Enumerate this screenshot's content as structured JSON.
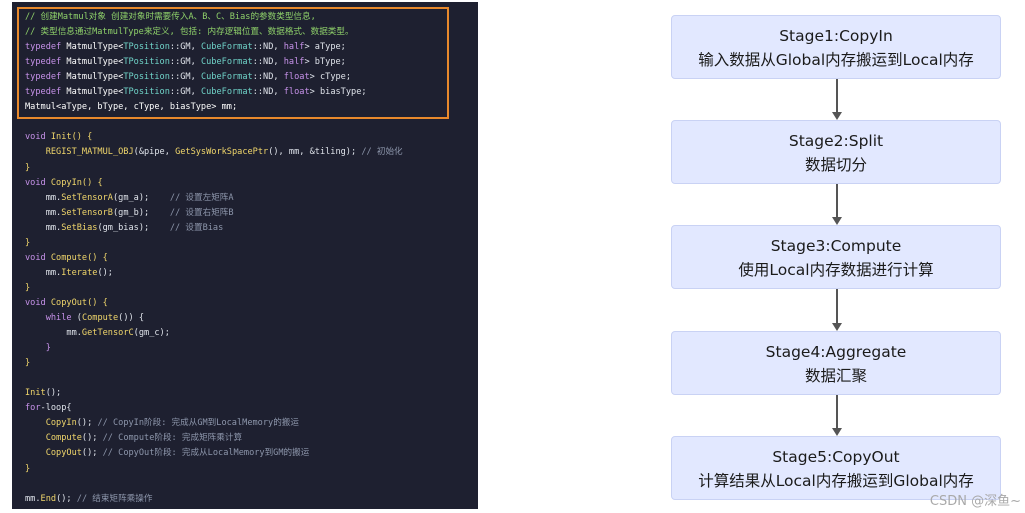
{
  "code": {
    "lines": [
      [
        [
          "// 创建Matmul对象 创建对象时需要传入A、B、C、Bias的参数类型信息,",
          "comment"
        ]
      ],
      [
        [
          "// 类型信息通过MatmulType来定义, 包括: 内存逻辑位置、数据格式、数据类型。",
          "comment"
        ]
      ],
      [
        [
          "typedef ",
          "keyword"
        ],
        [
          "MatmulType<",
          "type"
        ],
        [
          "TPosition",
          "enum"
        ],
        [
          "::GM, ",
          "plain"
        ],
        [
          "CubeFormat",
          "enum"
        ],
        [
          "::ND, ",
          "plain"
        ],
        [
          "half",
          "keyword"
        ],
        [
          "> aType;",
          "plain"
        ]
      ],
      [
        [
          "typedef ",
          "keyword"
        ],
        [
          "MatmulType<",
          "type"
        ],
        [
          "TPosition",
          "enum"
        ],
        [
          "::GM, ",
          "plain"
        ],
        [
          "CubeFormat",
          "enum"
        ],
        [
          "::ND, ",
          "plain"
        ],
        [
          "half",
          "keyword"
        ],
        [
          "> bType;",
          "plain"
        ]
      ],
      [
        [
          "typedef ",
          "keyword"
        ],
        [
          "MatmulType<",
          "type"
        ],
        [
          "TPosition",
          "enum"
        ],
        [
          "::GM, ",
          "plain"
        ],
        [
          "CubeFormat",
          "enum"
        ],
        [
          "::ND, ",
          "plain"
        ],
        [
          "float",
          "keyword"
        ],
        [
          "> cType;",
          "plain"
        ]
      ],
      [
        [
          "typedef ",
          "keyword"
        ],
        [
          "MatmulType<",
          "type"
        ],
        [
          "TPosition",
          "enum"
        ],
        [
          "::GM, ",
          "plain"
        ],
        [
          "CubeFormat",
          "enum"
        ],
        [
          "::ND, ",
          "plain"
        ],
        [
          "float",
          "keyword"
        ],
        [
          "> biasType;",
          "plain"
        ]
      ],
      [
        [
          "Matmul<aType, bType, cType, biasType> mm;",
          "type"
        ]
      ],
      [],
      [
        [
          "void ",
          "keyword"
        ],
        [
          "Init",
          "fn"
        ],
        [
          "() {",
          "punct"
        ]
      ],
      [
        [
          "    REGIST_MATMUL_OBJ",
          "macro"
        ],
        [
          "(&pipe, ",
          "plain"
        ],
        [
          "GetSysWorkSpacePtr",
          "fn"
        ],
        [
          "(), mm, &tiling); ",
          "plain"
        ],
        [
          "// 初始化",
          "comment-gray"
        ]
      ],
      [
        [
          "}",
          "punct"
        ]
      ],
      [
        [
          "void ",
          "keyword"
        ],
        [
          "CopyIn",
          "fn"
        ],
        [
          "() {",
          "punct"
        ]
      ],
      [
        [
          "    mm.",
          "plain"
        ],
        [
          "SetTensorA",
          "fn"
        ],
        [
          "(gm_a);    ",
          "plain"
        ],
        [
          "// 设置左矩阵A",
          "comment-gray"
        ]
      ],
      [
        [
          "    mm.",
          "plain"
        ],
        [
          "SetTensorB",
          "fn"
        ],
        [
          "(gm_b);    ",
          "plain"
        ],
        [
          "// 设置右矩阵B",
          "comment-gray"
        ]
      ],
      [
        [
          "    mm.",
          "plain"
        ],
        [
          "SetBias",
          "fn"
        ],
        [
          "(gm_bias);    ",
          "plain"
        ],
        [
          "// 设置Bias",
          "comment-gray"
        ]
      ],
      [
        [
          "}",
          "punct"
        ]
      ],
      [
        [
          "void ",
          "keyword"
        ],
        [
          "Compute",
          "fn"
        ],
        [
          "() {",
          "punct"
        ]
      ],
      [
        [
          "    mm.",
          "plain"
        ],
        [
          "Iterate",
          "fn"
        ],
        [
          "();",
          "plain"
        ]
      ],
      [
        [
          "}",
          "punct"
        ]
      ],
      [
        [
          "void ",
          "keyword"
        ],
        [
          "CopyOut",
          "fn"
        ],
        [
          "() {",
          "punct"
        ]
      ],
      [
        [
          "    while ",
          "keyword"
        ],
        [
          "(",
          "plain"
        ],
        [
          "Compute",
          "fn"
        ],
        [
          "()) {",
          "plain"
        ]
      ],
      [
        [
          "        mm.",
          "plain"
        ],
        [
          "GetTensorC",
          "fn"
        ],
        [
          "(gm_c);",
          "plain"
        ]
      ],
      [
        [
          "    }",
          "keyword"
        ]
      ],
      [
        [
          "}",
          "punct"
        ]
      ],
      [],
      [
        [
          "Init",
          "fn"
        ],
        [
          "();",
          "plain"
        ]
      ],
      [
        [
          "for",
          "keyword"
        ],
        [
          "-loop{",
          "plain"
        ]
      ],
      [
        [
          "    CopyIn",
          "fn"
        ],
        [
          "(); ",
          "plain"
        ],
        [
          "// CopyIn阶段: 完成从GM到LocalMemory的搬运",
          "comment-gray"
        ]
      ],
      [
        [
          "    Compute",
          "fn"
        ],
        [
          "(); ",
          "plain"
        ],
        [
          "// Compute阶段: 完成矩阵乘计算",
          "comment-gray"
        ]
      ],
      [
        [
          "    CopyOut",
          "fn"
        ],
        [
          "(); ",
          "plain"
        ],
        [
          "// CopyOut阶段: 完成从LocalMemory到GM的搬运",
          "comment-gray"
        ]
      ],
      [
        [
          "}",
          "punct"
        ]
      ],
      [],
      [
        [
          "mm.",
          "plain"
        ],
        [
          "End",
          "fn"
        ],
        [
          "(); ",
          "plain"
        ],
        [
          "// 结束矩阵乘操作",
          "comment-gray"
        ]
      ]
    ]
  },
  "flow": {
    "stages": [
      {
        "title": "Stage1:CopyIn",
        "desc": "输入数据从Global内存搬运到Local内存"
      },
      {
        "title": "Stage2:Split",
        "desc": "数据切分"
      },
      {
        "title": "Stage3:Compute",
        "desc": "使用Local内存数据进行计算"
      },
      {
        "title": "Stage4:Aggregate",
        "desc": "数据汇聚"
      },
      {
        "title": "Stage5:CopyOut",
        "desc": "计算结果从Local内存搬运到Global内存"
      }
    ]
  },
  "watermark": "CSDN @深鱼~",
  "colors": {
    "code_bg": "#1e2030",
    "highlight_border": "#e8892c",
    "box_fill": "#e2e8ff",
    "arrow": "#555555"
  }
}
